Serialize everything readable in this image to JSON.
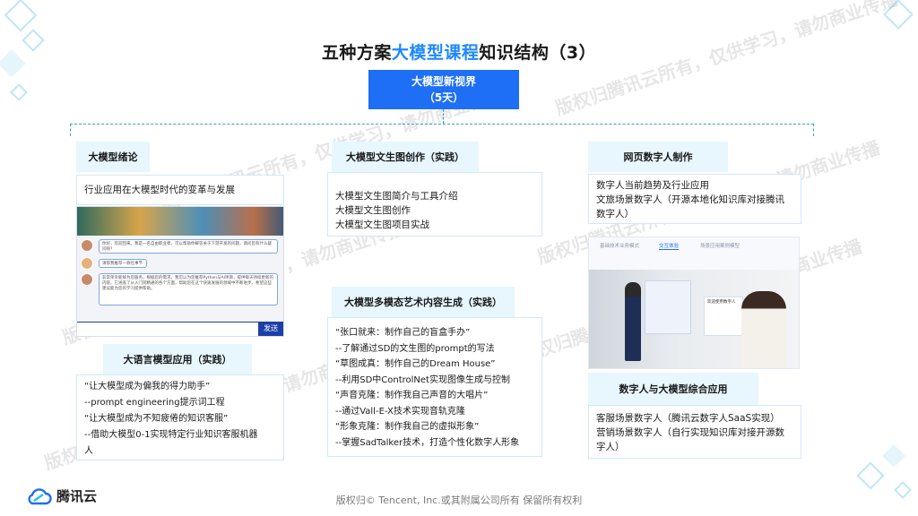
{
  "title": {
    "prefix": "五种方案",
    "highlight": "大模型课程",
    "suffix": "知识结构（3）"
  },
  "root": {
    "line1": "大模型新视界",
    "line2": "（5天）"
  },
  "cards": {
    "intro": {
      "head": "大模型绪论",
      "lines": [
        "行业应用在大模型时代的变革与发展"
      ]
    },
    "llm_app": {
      "head": "大语言模型应用（实践）",
      "lines": [
        "“让大模型成为偏我的得力助手”",
        "--prompt engineering提示词工程",
        "“让大模型成为不知疲倦的知识客服”",
        "--借助大模型0-1实现特定行业知识客服机器",
        "人"
      ]
    },
    "txt2img": {
      "head": "大模型文生图创作（实践）",
      "lines": [
        "大模型文生图简介与工具介绍",
        "大模型文生图创作",
        "大模型文生图项目实战"
      ]
    },
    "multimodal": {
      "head": "大模型多模态艺术内容生成（实践）",
      "lines": [
        "“张口就来：制作自己的盲盒手办”",
        "--了解通过SD的文生图的prompt的写法",
        "“草图成真：制作自己的Dream House”",
        "--利用SD中ControlNet实现图像生成与控制",
        "“声音克隆：制作我自己声音的大唱片”",
        "--通过Vall-E-X技术实现音轨克隆",
        "“形象克隆：制作我自己的虚拟形象”",
        "--掌握SadTalker技术，打造个性化数字人形象"
      ]
    },
    "web_dh": {
      "head": "网页数字人制作",
      "lines": [
        "数字人当前趋势及行业应用",
        "文旅场景数字人（开源本地化知识库对接腾讯",
        "数字人）"
      ]
    },
    "dh_llm": {
      "head": "数字人与大模型综合应用",
      "lines": [
        "客服场景数字人（腾讯云数字人SaaS实现）",
        "营销场景数字人（自行实现知识库对接开源数",
        "字人）"
      ]
    }
  },
  "chat_ui": {
    "msgs": [
      "你好，欢迎回来。我是一名自由职业者，可以帮助你解答关于下游开发的问题，请问您有什么疑问呢？",
      "请帮我推荐一款社事节",
      "非常荣幸能够为您服务。根据您的需求，我可以为您推荐Python与AI项目，提供每天持续更新的内容。它涵盖了从入门到精通的各个方面，帮助您在这个快速发展的领域中不断进步。希望这些建议能为您的学习提供帮助。"
    ],
    "send": "发送"
  },
  "dh_ui": {
    "tabs": [
      "基础技术业务模式",
      "交互体验",
      "场景应用案例模型"
    ],
    "panel_title": "欢迎使用数字人"
  },
  "watermark": "版权归腾讯云所有，仅供学习，请勿商业传播",
  "footer": "版权归© Tencent, Inc.或其附属公司所有 保留所有权利",
  "logo_text": "腾讯云",
  "colors": {
    "accent": "#1e88ff",
    "root_bg": "#1e6ff5",
    "head_bg": "#e8f6fd"
  }
}
